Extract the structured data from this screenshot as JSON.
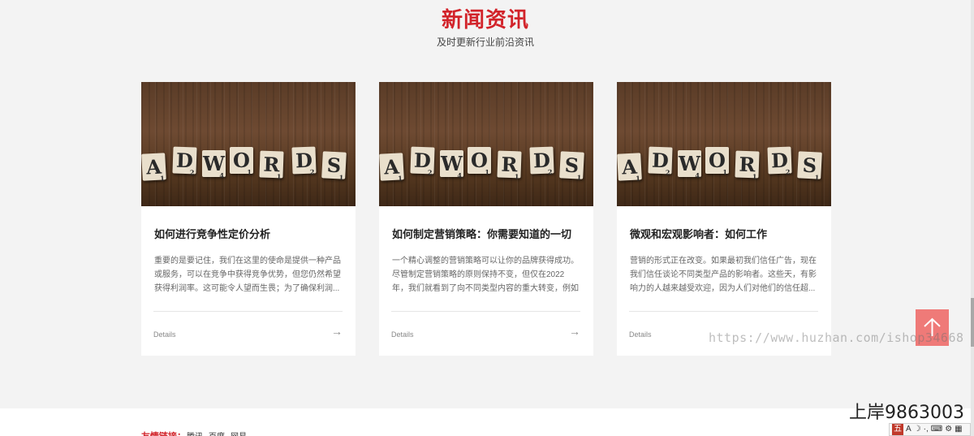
{
  "section": {
    "title": "新闻资讯",
    "subtitle": "及时更新行业前沿资讯"
  },
  "cards": [
    {
      "image_word": [
        "A",
        "D",
        "W",
        "O",
        "R",
        "D",
        "S"
      ],
      "image_sub": [
        "1",
        "2",
        "4",
        "1",
        "1",
        "2",
        "1"
      ],
      "title": "如何进行竞争性定价分析",
      "desc": "重要的是要记住，我们在这里的使命是提供一种产品或服务，可以在竞争中获得竞争优势，但您仍然希望获得利润率。这可能令人望而生畏；为了确保利润...",
      "details": "Details",
      "arrow": "→"
    },
    {
      "image_word": [
        "A",
        "D",
        "W",
        "O",
        "R",
        "D",
        "S"
      ],
      "image_sub": [
        "1",
        "2",
        "4",
        "1",
        "1",
        "2",
        "1"
      ],
      "title": "如何制定营销策略：你需要知道的一切",
      "desc": "一个精心调整的营销策略可以让你的品牌获得成功。尽管制定营销策略的原则保持不变，但仅在2022年，我们就看到了向不同类型内容的重大转变，例如短...",
      "details": "Details",
      "arrow": "→"
    },
    {
      "image_word": [
        "A",
        "D",
        "W",
        "O",
        "R",
        "D",
        "S"
      ],
      "image_sub": [
        "1",
        "2",
        "4",
        "1",
        "1",
        "2",
        "1"
      ],
      "title": "微观和宏观影响者：如何工作",
      "desc": "营销的形式正在改变。如果最初我们信任广告，现在我们信任谈论不同类型产品的影响者。这些天，有影响力的人越来越受欢迎，因为人们对他们的信任超...",
      "details": "Details",
      "arrow": ""
    }
  ],
  "footer": {
    "links_label": "友情链接：",
    "links": [
      "腾讯",
      "百度",
      "网易"
    ]
  },
  "overlay": {
    "watermark": "https://www.huzhan.com/ishop34668",
    "contact": "上岸9863003",
    "back_top_icon": "arrow-up-icon"
  },
  "ime_toolbar": {
    "items": [
      "五",
      "A",
      "☽",
      "·,",
      "⌨",
      "⚙",
      "▦"
    ]
  }
}
